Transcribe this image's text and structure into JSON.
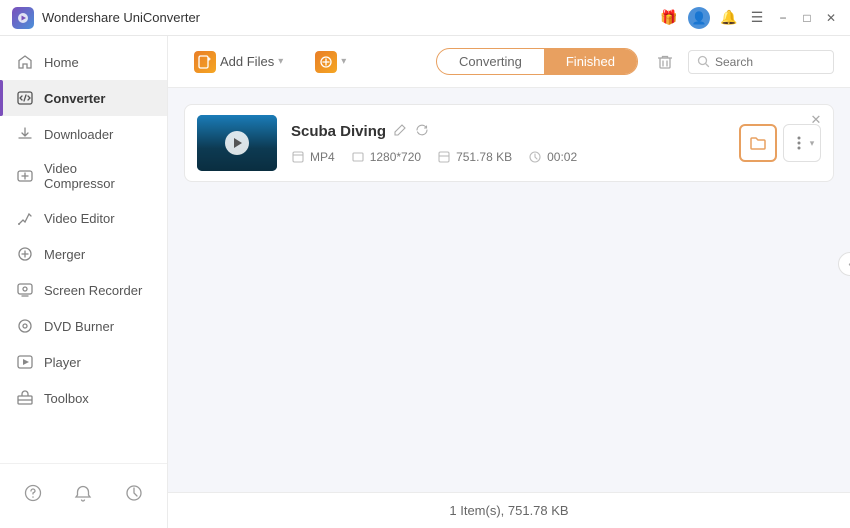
{
  "app": {
    "title": "Wondershare UniConverter",
    "logo_alt": "UniConverter Logo"
  },
  "titlebar": {
    "controls": {
      "gift_label": "gift",
      "user_label": "user",
      "bell_label": "bell",
      "menu_label": "menu",
      "minimize_label": "−",
      "maximize_label": "□",
      "close_label": "✕"
    }
  },
  "sidebar": {
    "items": [
      {
        "id": "home",
        "label": "Home",
        "icon": "🏠"
      },
      {
        "id": "converter",
        "label": "Converter",
        "icon": "⇄",
        "active": true
      },
      {
        "id": "downloader",
        "label": "Downloader",
        "icon": "⬇"
      },
      {
        "id": "video-compressor",
        "label": "Video Compressor",
        "icon": "⊡"
      },
      {
        "id": "video-editor",
        "label": "Video Editor",
        "icon": "✂"
      },
      {
        "id": "merger",
        "label": "Merger",
        "icon": "⊕"
      },
      {
        "id": "screen-recorder",
        "label": "Screen Recorder",
        "icon": "⬛"
      },
      {
        "id": "dvd-burner",
        "label": "DVD Burner",
        "icon": "💿"
      },
      {
        "id": "player",
        "label": "Player",
        "icon": "▶"
      },
      {
        "id": "toolbox",
        "label": "Toolbox",
        "icon": "⚙"
      }
    ],
    "bottom": [
      {
        "id": "help",
        "icon": "?"
      },
      {
        "id": "notifications",
        "icon": "🔔"
      },
      {
        "id": "feedback",
        "icon": "↺"
      }
    ]
  },
  "toolbar": {
    "add_file_label": "Add Files",
    "add_file_icon": "📄",
    "add_button_label": "+",
    "tabs": {
      "converting_label": "Converting",
      "finished_label": "Finished",
      "active": "finished"
    },
    "search_placeholder": "Search"
  },
  "file_list": {
    "items": [
      {
        "id": "scuba-diving",
        "name": "Scuba Diving",
        "format": "MP4",
        "resolution": "1280*720",
        "size": "751.78 KB",
        "duration": "00:02"
      }
    ]
  },
  "status_bar": {
    "text": "1 Item(s), 751.78 KB"
  }
}
